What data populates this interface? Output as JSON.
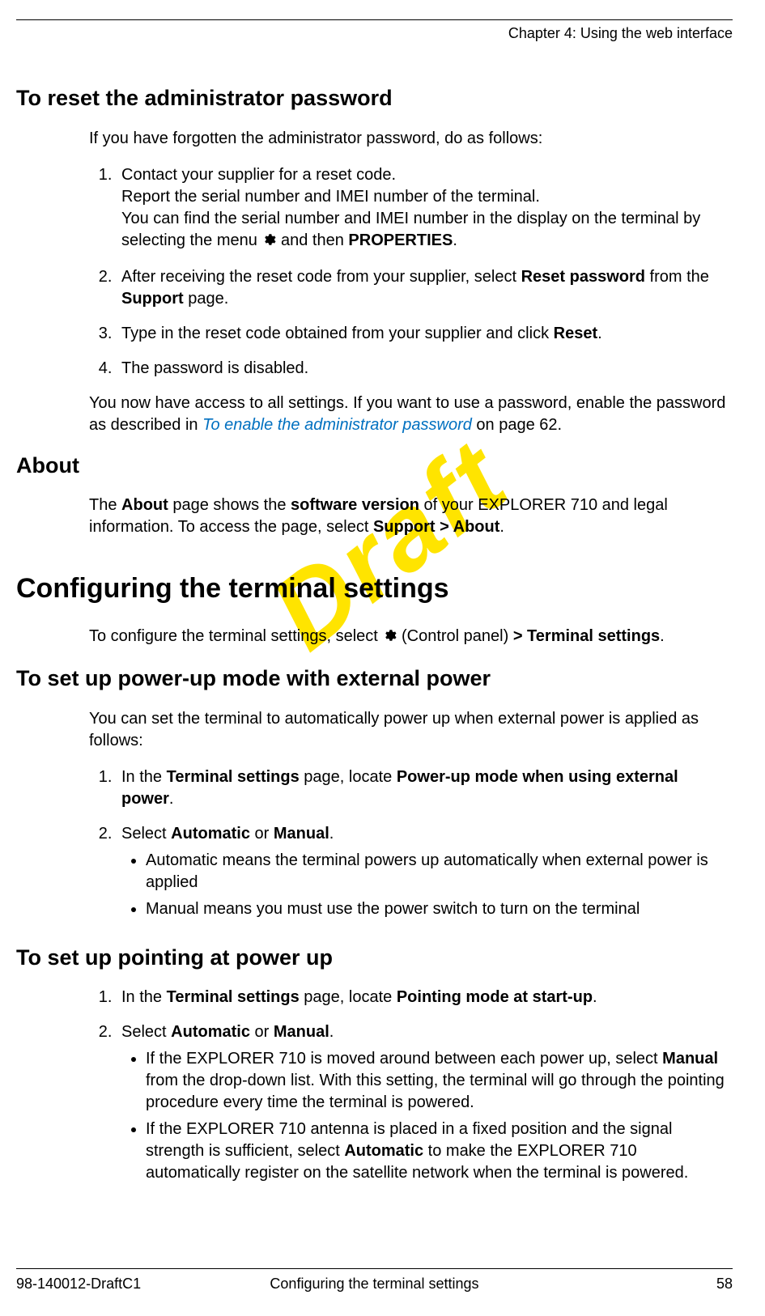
{
  "runningHead": "Chapter 4: Using the web interface",
  "watermark": "Draft",
  "s1": {
    "heading": "To reset the administrator password",
    "intro": "If you have forgotten the administrator password, do as follows:",
    "step1a": "Contact your supplier for a reset code.",
    "step1b": "Report the serial number and IMEI number of the terminal.",
    "step1c_pre": "You can find the serial number and IMEI number in the display on the terminal by selecting the menu ",
    "step1c_post": " and then ",
    "step1c_bold": "PROPERTIES",
    "step1c_end": ".",
    "step2_pre": "After receiving the reset code from your supplier, select ",
    "step2_b1": "Reset password",
    "step2_mid": " from the ",
    "step2_b2": "Support",
    "step2_end": " page.",
    "step3_pre": "Type in the reset code obtained from your supplier and click ",
    "step3_b": "Reset",
    "step3_end": ".",
    "step4": "The password is disabled.",
    "outro_pre": "You now have access to all settings. If you want to use a password, enable the password as described in ",
    "outro_link": "To enable the administrator password",
    "outro_post": " on page 62."
  },
  "s2": {
    "heading": "About",
    "p_pre": "The ",
    "p_b1": "About",
    "p_mid1": " page shows the ",
    "p_b2": "software version",
    "p_mid2": " of your EXPLORER 710 and legal information. To access the page, select ",
    "p_b3": "Support > About",
    "p_end": "."
  },
  "s3": {
    "heading": "Configuring the terminal settings",
    "p_pre": "To configure the terminal settings, select ",
    "p_mid": " (Control panel) ",
    "p_b": "> Terminal settings",
    "p_end": "."
  },
  "s4": {
    "heading": "To set up power-up mode with external power",
    "intro": "You can set the terminal to automatically power up when external power is applied as follows:",
    "step1_pre": "In the ",
    "step1_b1": "Terminal settings",
    "step1_mid": " page, locate ",
    "step1_b2": "Power-up mode when using external power",
    "step1_end": ".",
    "step2_pre": "Select ",
    "step2_b1": "Automatic",
    "step2_mid": " or ",
    "step2_b2": "Manual",
    "step2_end": ".",
    "bul1": "Automatic means the terminal powers up automatically when external power is applied",
    "bul2": "Manual means you must use the power switch to turn on the terminal"
  },
  "s5": {
    "heading": "To set up pointing at power up",
    "step1_pre": "In the ",
    "step1_b1": "Terminal settings",
    "step1_mid": " page, locate ",
    "step1_b2": "Pointing mode at start-up",
    "step1_end": ".",
    "step2_pre": "Select ",
    "step2_b1": "Automatic",
    "step2_mid": " or ",
    "step2_b2": "Manual",
    "step2_end": ".",
    "bul1_pre": "If the EXPLORER 710 is moved around between each power up, select ",
    "bul1_b": "Manual",
    "bul1_post": " from the drop-down list. With this setting, the terminal will go through the pointing procedure every time the terminal is powered.",
    "bul2_pre": "If the EXPLORER 710 antenna is placed in a fixed position and the signal strength is sufficient, select ",
    "bul2_b": "Automatic",
    "bul2_post": " to make the EXPLORER 710 automatically register on the satellite network when the terminal is powered."
  },
  "footer": {
    "left": "98-140012-DraftC1",
    "center": "Configuring the terminal settings",
    "right": "58"
  }
}
